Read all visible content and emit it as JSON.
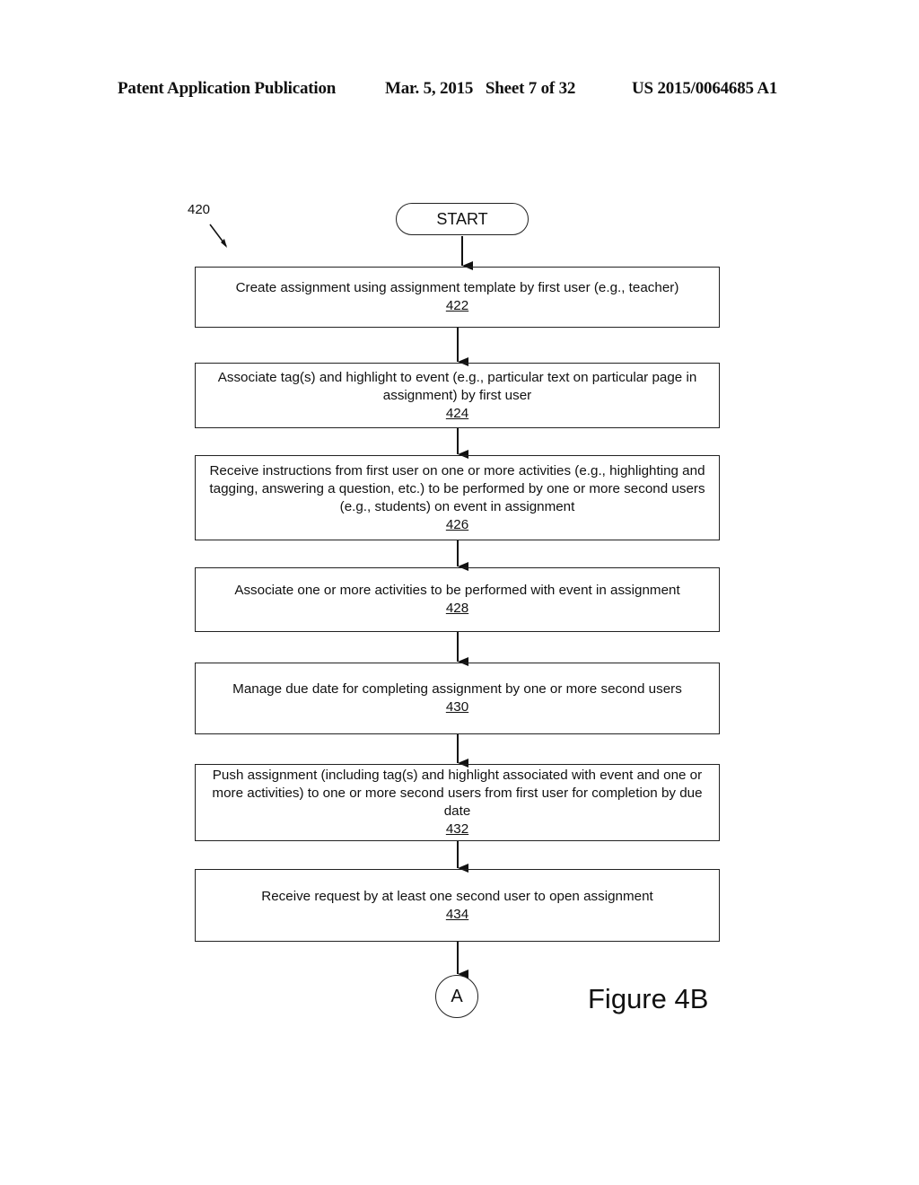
{
  "header": {
    "publication": "Patent Application Publication",
    "date_sheet": "Mar. 5, 2015   Sheet 7 of 32",
    "patent_number": "US 2015/0064685 A1"
  },
  "diagram": {
    "reference_label": "420",
    "start_label": "START",
    "steps": [
      {
        "text": "Create assignment using assignment template by first user (e.g., teacher)",
        "number": "422"
      },
      {
        "text": "Associate tag(s) and highlight to event (e.g., particular text on particular page in assignment) by first user",
        "number": "424"
      },
      {
        "text": "Receive instructions from first user on one or more activities (e.g., highlighting and tagging, answering a question, etc.) to be performed by one or more second users (e.g., students) on event in assignment",
        "number": "426"
      },
      {
        "text": "Associate one or more activities to be performed with event in assignment",
        "number": "428"
      },
      {
        "text": "Manage due date for completing assignment by one or more second users",
        "number": "430"
      },
      {
        "text": "Push assignment (including tag(s) and highlight associated with event and one or more activities) to one or more second users from first user for completion by due date",
        "number": "432"
      },
      {
        "text": "Receive request by at least one second user to open assignment",
        "number": "434"
      }
    ],
    "connector_label": "A",
    "figure_label": "Figure 4B"
  }
}
